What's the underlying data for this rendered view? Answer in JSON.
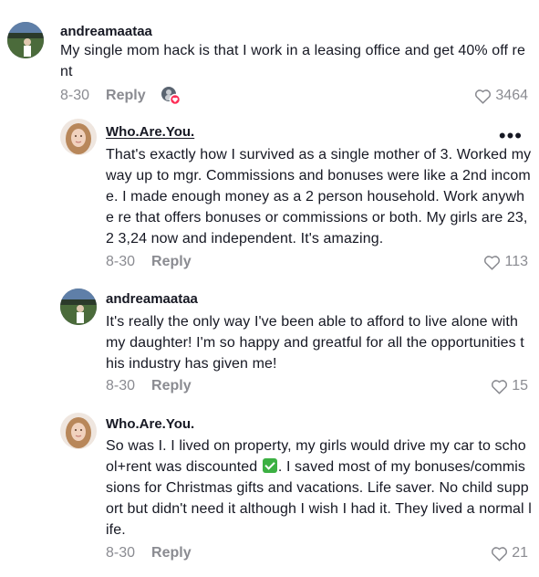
{
  "comments": [
    {
      "username": "andreamaataa",
      "text": "My single mom hack is that I work in a leasing office and get 40% off re nt",
      "date": "8-30",
      "reply": "Reply",
      "likes": "3464"
    },
    {
      "username": "Who.Are.You.",
      "text": "That's exactly how I survived as a single mother of 3. Worked my way up to mgr. Commissions and bonuses were like a 2nd incom e. I made enough money as a 2 person household. Work anywhe re that offers bonuses or commissions or both. My girls are 23,2 3,24 now and independent. It's amazing.",
      "date": "8-30",
      "reply": "Reply",
      "likes": "113",
      "more": "•••"
    },
    {
      "username": "andreamaataa",
      "text": "It's really the only way I've been able to afford to live alone with my daughter! I'm so happy and greatful for all the opportunities t his industry has given me!",
      "date": "8-30",
      "reply": "Reply",
      "likes": "15"
    },
    {
      "username": "Who.Are.You.",
      "text_before": "So was I. I lived on property, my girls would drive my car to scho ol+rent was discounted",
      "emoji": "check-mark-button",
      "text_after": ". I saved most of my bonuses/commis sions for Christmas gifts and vacations. Life saver. No child supp ort but didn't need it although I wish I had it. They lived a normal life.",
      "date": "8-30",
      "reply": "Reply",
      "likes": "21"
    }
  ],
  "colors": {
    "text": "#161823",
    "muted": "#8a8b91",
    "emoji_green": "#3cb043"
  },
  "icons": {
    "heart": "heart-outline-icon",
    "more": "more-horizontal-icon",
    "creator_liked": "creator-liked-icon"
  }
}
